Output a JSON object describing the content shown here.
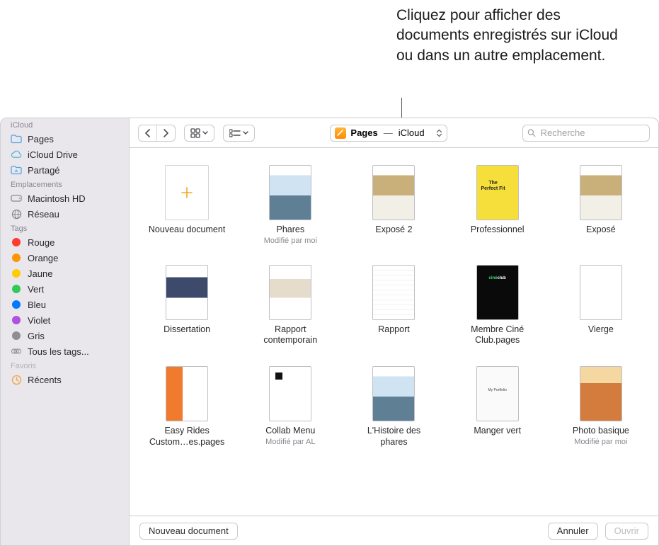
{
  "callout": "Cliquez pour afficher des documents enregistrés sur iCloud ou dans un autre emplacement.",
  "location": {
    "app": "Pages",
    "sep": "—",
    "place": "iCloud"
  },
  "search": {
    "placeholder": "Recherche"
  },
  "sidebar": {
    "sections": [
      {
        "heading": "iCloud",
        "items": [
          {
            "label": "Pages",
            "icon": "folder-icon",
            "color": "#54a6e4"
          },
          {
            "label": "iCloud Drive",
            "icon": "cloud-icon",
            "color": "#58b6d6"
          },
          {
            "label": "Partagé",
            "icon": "shared-folder-icon",
            "color": "#54a6e4"
          }
        ]
      },
      {
        "heading": "Emplacements",
        "items": [
          {
            "label": "Macintosh HD",
            "icon": "hdd-icon",
            "color": "#8b8b92"
          },
          {
            "label": "Réseau",
            "icon": "globe-icon",
            "color": "#8b8b92"
          }
        ]
      },
      {
        "heading": "Tags",
        "items": [
          {
            "label": "Rouge",
            "icon": "tag-dot",
            "color": "#ff3b30"
          },
          {
            "label": "Orange",
            "icon": "tag-dot",
            "color": "#ff9500"
          },
          {
            "label": "Jaune",
            "icon": "tag-dot",
            "color": "#ffcc00"
          },
          {
            "label": "Vert",
            "icon": "tag-dot",
            "color": "#34c759"
          },
          {
            "label": "Bleu",
            "icon": "tag-dot",
            "color": "#007aff"
          },
          {
            "label": "Violet",
            "icon": "tag-dot",
            "color": "#af52de"
          },
          {
            "label": "Gris",
            "icon": "tag-dot",
            "color": "#8e8e93"
          },
          {
            "label": "Tous les tags...",
            "icon": "tag-all",
            "color": "#8e8e93"
          }
        ]
      },
      {
        "heading": "Favoris",
        "faded": true,
        "items": [
          {
            "label": "Récents",
            "icon": "clock-icon",
            "color": "#f2a33a"
          }
        ]
      }
    ]
  },
  "files": [
    {
      "name": "Nouveau document",
      "meta": "",
      "thumb": "new"
    },
    {
      "name": "Phares",
      "meta": "Modifié par moi",
      "thumb": "lighthouse"
    },
    {
      "name": "Exposé 2",
      "meta": "",
      "thumb": "wildlife"
    },
    {
      "name": "Professionnel",
      "meta": "",
      "thumb": "yellowbook"
    },
    {
      "name": "Exposé",
      "meta": "",
      "thumb": "wildlife"
    },
    {
      "name": "Dissertation",
      "meta": "",
      "thumb": "dissertation"
    },
    {
      "name": "Rapport contemporain",
      "meta": "",
      "thumb": "interior"
    },
    {
      "name": "Rapport",
      "meta": "",
      "thumb": "report"
    },
    {
      "name": "Membre Ciné Club.pages",
      "meta": "",
      "thumb": "cineclub"
    },
    {
      "name": "Vierge",
      "meta": "",
      "thumb": "blank"
    },
    {
      "name": "Easy Rides Custom…es.pages",
      "meta": "",
      "thumb": "bikes"
    },
    {
      "name": "Collab Menu",
      "meta": "Modifié par AL",
      "thumb": "menu"
    },
    {
      "name": "L'Histoire des phares",
      "meta": "",
      "thumb": "lighthouse"
    },
    {
      "name": "Manger vert",
      "meta": "",
      "thumb": "portfolio"
    },
    {
      "name": "Photo basique",
      "meta": "Modifié par moi",
      "thumb": "desert"
    }
  ],
  "footer": {
    "new": "Nouveau document",
    "cancel": "Annuler",
    "open": "Ouvrir"
  }
}
